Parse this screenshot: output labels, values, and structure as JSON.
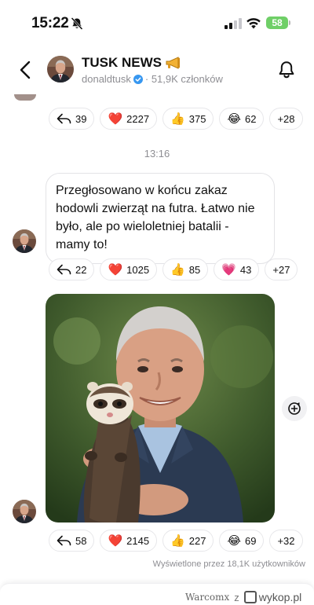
{
  "status_bar": {
    "time": "15:22",
    "battery": "58",
    "icons": [
      "bell-muted-icon",
      "cellular-signal-icon",
      "wifi-icon",
      "battery-icon"
    ]
  },
  "header": {
    "title": "TUSK NEWS",
    "title_emoji": "megaphone-icon",
    "handle": "donaldtusk",
    "members": "· 51,9K członków",
    "icons": [
      "back-arrow-icon",
      "verified-badge-icon",
      "notification-bell-icon"
    ]
  },
  "feed": {
    "reactions_top": [
      {
        "type": "reply",
        "count": "39"
      },
      {
        "emoji": "❤️",
        "count": "2227"
      },
      {
        "emoji": "👍",
        "count": "375"
      },
      {
        "emoji": "😂",
        "count": "62"
      },
      {
        "more": "+28"
      }
    ],
    "timestamp": "13:16",
    "text_post": {
      "text": "Przegłosowano w końcu zakaz hodowli zwierząt na futra. Łatwo nie było, ale po wieloletniej batalii - mamy to!",
      "reactions": [
        {
          "type": "reply",
          "count": "22"
        },
        {
          "emoji": "❤️",
          "count": "1025"
        },
        {
          "emoji": "👍",
          "count": "85"
        },
        {
          "emoji": "💗",
          "count": "43"
        },
        {
          "more": "+27"
        }
      ]
    },
    "photo_post": {
      "reactions": [
        {
          "type": "reply",
          "count": "58"
        },
        {
          "emoji": "❤️",
          "count": "2145"
        },
        {
          "emoji": "👍",
          "count": "227"
        },
        {
          "emoji": "😂",
          "count": "69"
        },
        {
          "more": "+32"
        }
      ],
      "views": "Wyświetlone przez 18,1K użytkowników"
    }
  },
  "watermark": {
    "user": "Warcomx",
    "letter": "z",
    "site": "wykop.pl"
  },
  "colors": {
    "accent_verified": "#3797f0",
    "heart": "#e0245e",
    "battery": "#6fcf67",
    "muted_text": "#8e8e93"
  }
}
